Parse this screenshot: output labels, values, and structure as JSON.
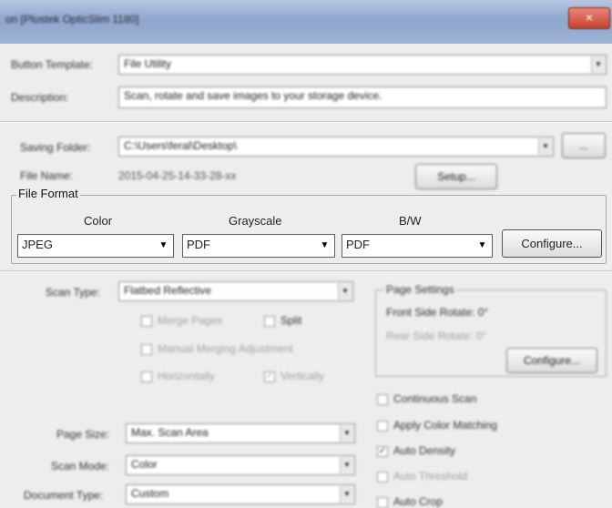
{
  "window": {
    "title": "on [Plustek OpticSlim 1180]",
    "close": "×"
  },
  "top": {
    "button_template_label": "Button Template:",
    "button_template_value": "File Utility",
    "description_label": "Description:",
    "description_value": "Scan, rotate and save images to your storage device."
  },
  "saving": {
    "folder_label": "Saving Folder:",
    "folder_value": "C:\\Users\\feral\\Desktop\\",
    "browse_label": "...",
    "file_name_label": "File Name:",
    "file_name_value": "2015-04-25-14-33-28-xx",
    "setup_label": "Setup..."
  },
  "file_format": {
    "legend": "File Format",
    "color_label": "Color",
    "color_value": "JPEG",
    "grayscale_label": "Grayscale",
    "grayscale_value": "PDF",
    "bw_label": "B/W",
    "bw_value": "PDF",
    "configure_label": "Configure..."
  },
  "scan": {
    "scan_type_label": "Scan Type:",
    "scan_type_value": "Flatbed Reflective",
    "merge_pages": "Merge Pages",
    "split": "Split",
    "manual_merging": "Manual Merging Adjustment",
    "horizontally": "Horizontally",
    "vertically": "Vertically",
    "page_size_label": "Page Size:",
    "page_size_value": "Max. Scan Area",
    "scan_mode_label": "Scan Mode:",
    "scan_mode_value": "Color",
    "document_type_label": "Document Type:",
    "document_type_value": "Custom"
  },
  "page_settings": {
    "title": "Page Settings",
    "front_rotate": "Front Side Rotate: 0°",
    "rear_rotate": "Rear Side Rotate: 0°",
    "configure_label": "Configure..."
  },
  "options": {
    "continuous_scan": "Continuous Scan",
    "apply_color_matching": "Apply Color Matching",
    "auto_density": "Auto Density",
    "auto_threshold": "Auto Threshold",
    "auto_crop": "Auto Crop"
  }
}
